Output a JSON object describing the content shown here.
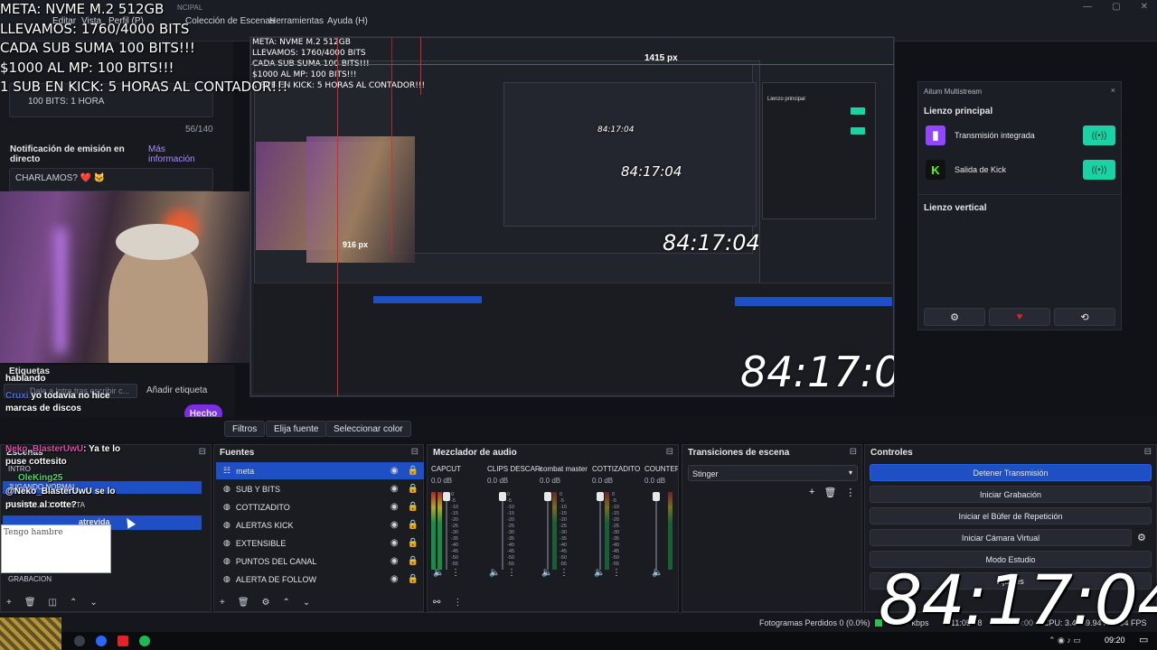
{
  "menubar": {
    "items": [
      "Editar",
      "Vista",
      "Perfil (P)",
      "Colección de Escenas",
      "Herramientas",
      "Ayuda (H)"
    ],
    "title_fragment": "NCIPAL"
  },
  "overlay": {
    "lines": [
      "META: NVME M.2 512GB",
      "LLEVAMOS: 1760/4000 BITS",
      "CADA SUB SUMA 100 BITS!!!",
      "$1000 AL MP: 100 BITS!!!",
      "1 SUB EN KICK: 5 HORAS AL CONTADOR!!!"
    ]
  },
  "chat_panel": {
    "bits_line": "100 BITS: 1 HORA",
    "counter": "56/140",
    "notif_title": "Notificación de emisión en directo",
    "more_info": "Más información",
    "notif_text": "CHARLAMOS? ❤️ 🐱"
  },
  "preview": {
    "width_label_top": "1415 px",
    "width_label_mid": "916 px",
    "timers": [
      "84:17:04",
      "84:17:04",
      "84:17:04",
      "84:17:04"
    ]
  },
  "multistream": {
    "header": "Aitum Multistream",
    "main_canvas": "Lienzo principal",
    "vertical_canvas": "Lienzo vertical",
    "outputs": [
      {
        "name": "Transmisión integrada",
        "logo": "twitch-icon",
        "color": "#9146ff"
      },
      {
        "name": "Salida de Kick",
        "logo": "kick-icon",
        "color": "#53fc18"
      }
    ]
  },
  "tags": {
    "title": "Etiquetas",
    "input_placeholder": "Dale a Intro tras escribir c...",
    "add_tag": "Añadir etiqueta",
    "done": "Hecho",
    "chat_user1": "Cruxi",
    "chat_msg1": "yo todavia no hice marcas de discos",
    "speaking": "hablando"
  },
  "filter_row": {
    "filters": "Filtros",
    "choose_source": "Elija fuente",
    "select_color": "Seleccionar color"
  },
  "scenes": {
    "title": "Escenas",
    "items": [
      "INTRO",
      "JUGANDO NORMAL",
      "PANTALLA COMPLETA",
      "atrevida",
      "",
      "GRABACION"
    ],
    "text_box": "Tengo hambre",
    "chat": [
      {
        "user": "Neko_BlasterUwU",
        "msg": "Ya te lo puse cottesito"
      },
      {
        "user": "OleKing25",
        "msg": ""
      },
      {
        "user": "@Neko_BlasterUwU",
        "msg": "se lo pusiste al cotte?"
      }
    ]
  },
  "sources": {
    "title": "Fuentes",
    "items": [
      "meta",
      "SUB Y BITS",
      "COTTIZADITO",
      "ALERTAS KICK",
      "EXTENSIBLE",
      "PUNTOS DEL CANAL",
      "ALERTA DE FOLLOW"
    ]
  },
  "mixer": {
    "title": "Mezclador de audio",
    "channels": [
      {
        "name": "CAPCUT",
        "db": "0.0 dB"
      },
      {
        "name": "CLIPS DESCARGADOS",
        "db": "0.0 dB"
      },
      {
        "name": "combat master",
        "db": "0.0 dB"
      },
      {
        "name": "COTTIZADITO",
        "db": "0.0 dB"
      },
      {
        "name": "COUNTER S",
        "db": "0.0 dB"
      }
    ],
    "scale": [
      "0",
      "-5",
      "-10",
      "-15",
      "-20",
      "-25",
      "-30",
      "-35",
      "-40",
      "-45",
      "-50",
      "-55",
      "-60"
    ]
  },
  "transitions": {
    "title": "Transiciones de escena",
    "selected": "Stinger"
  },
  "controls": {
    "title": "Controles",
    "buttons": [
      "Detener Transmisión",
      "Iniciar Grabación",
      "Iniciar el Búfer de Repetición",
      "Iniciar Cámara Virtual",
      "Modo Estudio",
      "Ajustes"
    ]
  },
  "status": {
    "dropped_frames": "Fotogramas Perdidos 0 (0.0%)",
    "bitrate": "5877 kbps",
    "live_time": "11:05:58",
    "rec_time": "00:00:00",
    "cpu": "CPU: 3.4%",
    "fps": "59.94 / 59.94 FPS"
  },
  "taskbar": {
    "clock": "09:20"
  },
  "big_clock": "84:17:04"
}
